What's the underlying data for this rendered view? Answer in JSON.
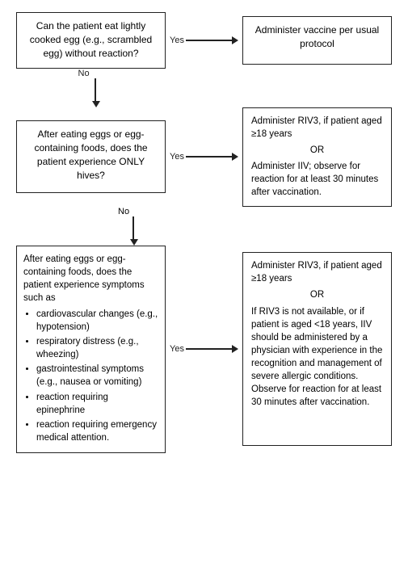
{
  "boxes": {
    "q1": "Can the patient eat lightly cooked egg (e.g., scrambled egg) without reaction?",
    "a1": "Administer vaccine per usual protocol",
    "q2": "After eating eggs or egg-containing foods, does the patient experience ONLY hives?",
    "a2_title": "Administer RIV3, if patient aged ≥18 years",
    "a2_or": "OR",
    "a2_body": "Administer IIV; observe for reaction for at least 30 minutes after vaccination.",
    "q3_intro": "After eating eggs or egg-containing foods, does the patient experience symptoms such as",
    "q3_items": [
      "cardiovascular changes (e.g., hypotension)",
      "respiratory distress (e.g., wheezing)",
      "gastrointestinal symptoms (e.g., nausea or vomiting)",
      "reaction requiring epinephrine",
      "reaction requiring emergency medical attention."
    ],
    "a3_line1": "Administer RIV3, if patient aged ≥18 years",
    "a3_or": "OR",
    "a3_body": "If RIV3 is not available, or if patient is aged <18 years, IIV should be administered by a physician with experience in the recognition and management of severe allergic conditions. Observe for reaction for at least 30 minutes after vaccination.",
    "yes": "Yes",
    "no": "No"
  }
}
